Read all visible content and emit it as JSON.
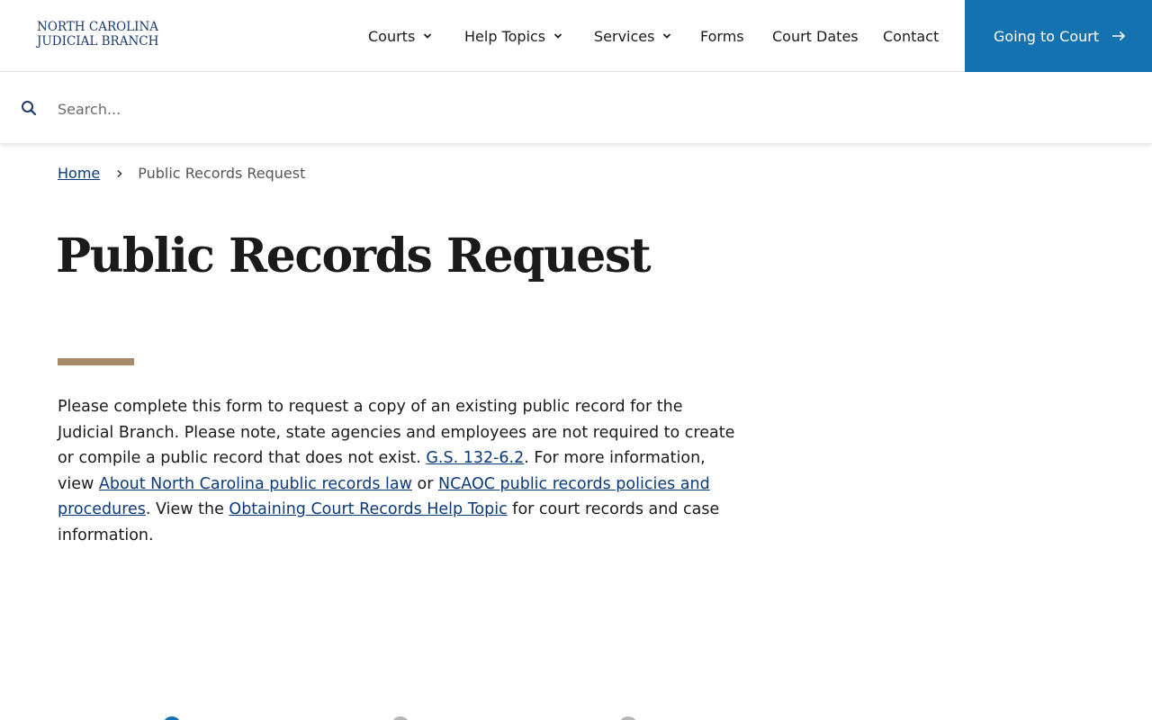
{
  "header": {
    "logo_line1": "NORTH CAROLINA",
    "logo_line2": "JUDICIAL BRANCH",
    "nav": {
      "courts": "Courts",
      "help_topics": "Help Topics",
      "services": "Services",
      "forms": "Forms",
      "court_dates": "Court Dates",
      "contact": "Contact"
    },
    "cta_label": "Going to Court"
  },
  "search": {
    "placeholder": "Search...",
    "value": ""
  },
  "breadcrumb": {
    "home": "Home",
    "current": "Public Records Request"
  },
  "page": {
    "title": "Public Records Request",
    "intro": {
      "t1": "Please complete this form to request a copy of an existing public record for the Judicial Branch. Please note, state agencies and employees are not required to create or compile a public record that does not exist. ",
      "link1": "G.S. 132-6.2",
      "t2": ". For more information, view ",
      "link2": "About North Carolina public records law",
      "t3": " or ",
      "link3": "NCAOC public records policies and procedures",
      "t4": ". View the ",
      "link4": "Obtaining Court Records Help Topic",
      "t5": " for court records and case information."
    }
  },
  "colors": {
    "brand_navy": "#1b3a6b",
    "cta_blue": "#1572b1",
    "accent_tan": "#a58c66",
    "link": "#0b3a7a",
    "step_active": "#1572b1",
    "step_inactive": "#b5b5b5"
  },
  "icons": {
    "search": "search-icon",
    "chevron": "chevron-down-icon",
    "arrow": "arrow-right-icon",
    "breadcrumb_sep": "chevron-right-icon"
  }
}
